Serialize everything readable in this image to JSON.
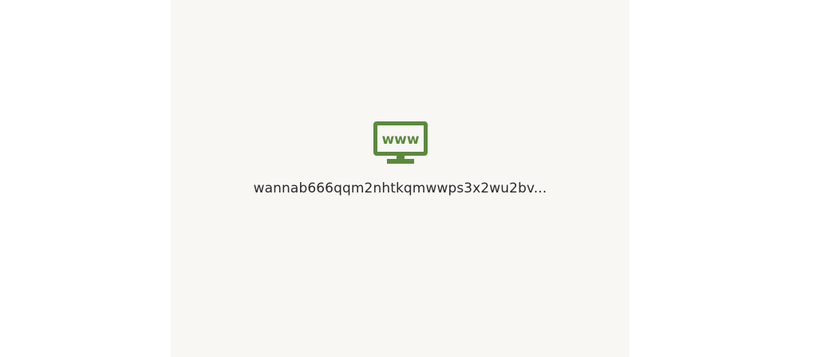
{
  "colors": {
    "background": "#f8f7f3",
    "accent": "#5b8a3c",
    "text": "#2a2a2a"
  },
  "site": {
    "icon": "monitor-www-icon",
    "icon_text": "www",
    "label": "wannab666qqm2nhtkqmwwps3x2wu2bv..."
  }
}
